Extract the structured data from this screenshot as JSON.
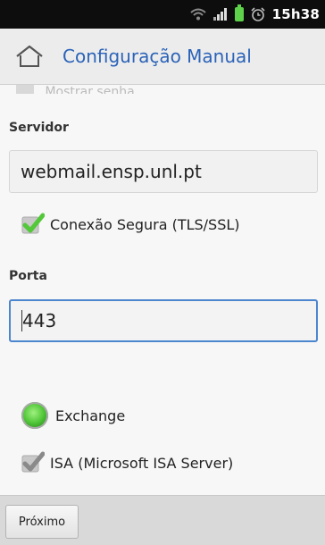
{
  "statusbar": {
    "time": "15h38",
    "icons": [
      "wifi-icon",
      "signal-icon",
      "battery-icon",
      "alarm-icon"
    ]
  },
  "titlebar": {
    "title": "Configuração Manual",
    "home_icon": "home-icon"
  },
  "form": {
    "cut_label": "Mostrar senha",
    "server_label": "Servidor",
    "server_value": "webmail.ensp.unl.pt",
    "secure_label": "Conexão Segura (TLS/SSL)",
    "secure_checked": true,
    "port_label": "Porta",
    "port_value": "443",
    "exchange_label": "Exchange",
    "exchange_selected": true,
    "isa_label": "ISA (Microsoft ISA Server)",
    "isa_checked": true
  },
  "bottombar": {
    "next_label": "Próximo"
  },
  "colors": {
    "accent": "#2b63b8",
    "check_green": "#53c83a",
    "check_gray": "#8a8a8a"
  }
}
